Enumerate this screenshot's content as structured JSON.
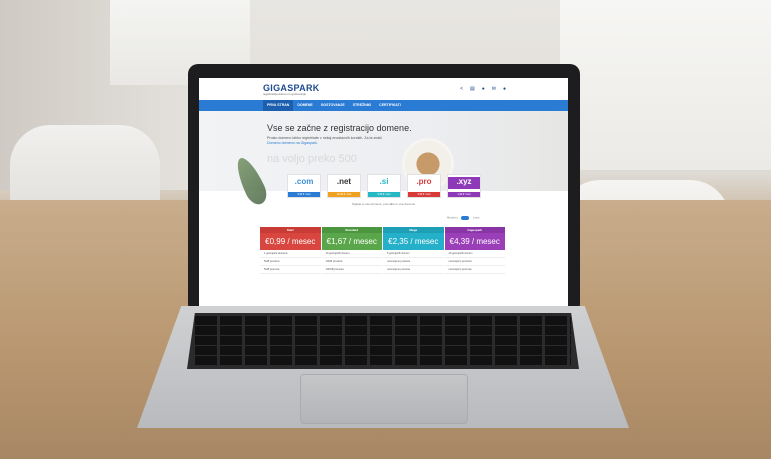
{
  "site": {
    "logo": "GIGASPARK",
    "tagline": "registracija domen in gostovanje",
    "header_icons": [
      "share-icon",
      "cart-icon",
      "globe-icon",
      "mail-icon",
      "user-icon"
    ],
    "nav": [
      "PRVA STRAN",
      "DOMENE",
      "GOSTOVANJE",
      "STREŽNIKI",
      "CERTIFIKATI"
    ],
    "hero_title": "Vse se začne z registracijo domene.",
    "hero_line1": "Prosto domeno lahko registrirate v nekaj enostavnih korakih. Za ta znaki",
    "hero_line2": "Domeno domeno na Gigaspark.",
    "hero_big": "na voljo preko 500",
    "tlds": [
      {
        "name": ".com",
        "price": "9,99 € / leto",
        "color": "#2a7bd4"
      },
      {
        "name": ".net",
        "price": "10,99 € / leto",
        "color": "#f0a020"
      },
      {
        "name": ".si",
        "price": "9,99 € / leto",
        "color": "#26b8c4"
      },
      {
        "name": ".pro",
        "price": "3,99 € / leto",
        "color": "#d83a3a"
      },
      {
        "name": ".xyz",
        "price": "1,99 € / leto",
        "color": "#8e3ab8"
      }
    ],
    "offer_line": "Oglejte si vse domene, ponudbe in vse domene",
    "toggle_left": "Mesečno",
    "toggle_right": "Letno",
    "plans": [
      {
        "name": "Start",
        "price": "€0,99 / mesec",
        "color": "#d8463f",
        "features": [
          "1 gostujoča domena",
          "5GB prostora",
          "5GB prenosa"
        ]
      },
      {
        "name": "Standard",
        "price": "€1,67 / mesec",
        "color": "#5aa64a",
        "features": [
          "10 gostujočih domen",
          "10GB prostora",
          "100GB prenosa"
        ]
      },
      {
        "name": "Mega",
        "price": "€2,35 / mesec",
        "color": "#23b0c8",
        "features": [
          "5 gostujočih domen",
          "neomejeno prostora",
          "neomejeno prenosa"
        ]
      },
      {
        "name": "Gigaspark",
        "price": "€4,39 / mesec",
        "color": "#9a3fb8",
        "features": [
          "25 gostujočih domen",
          "neomejeno prostora",
          "neomejeno prenosa"
        ]
      }
    ]
  }
}
